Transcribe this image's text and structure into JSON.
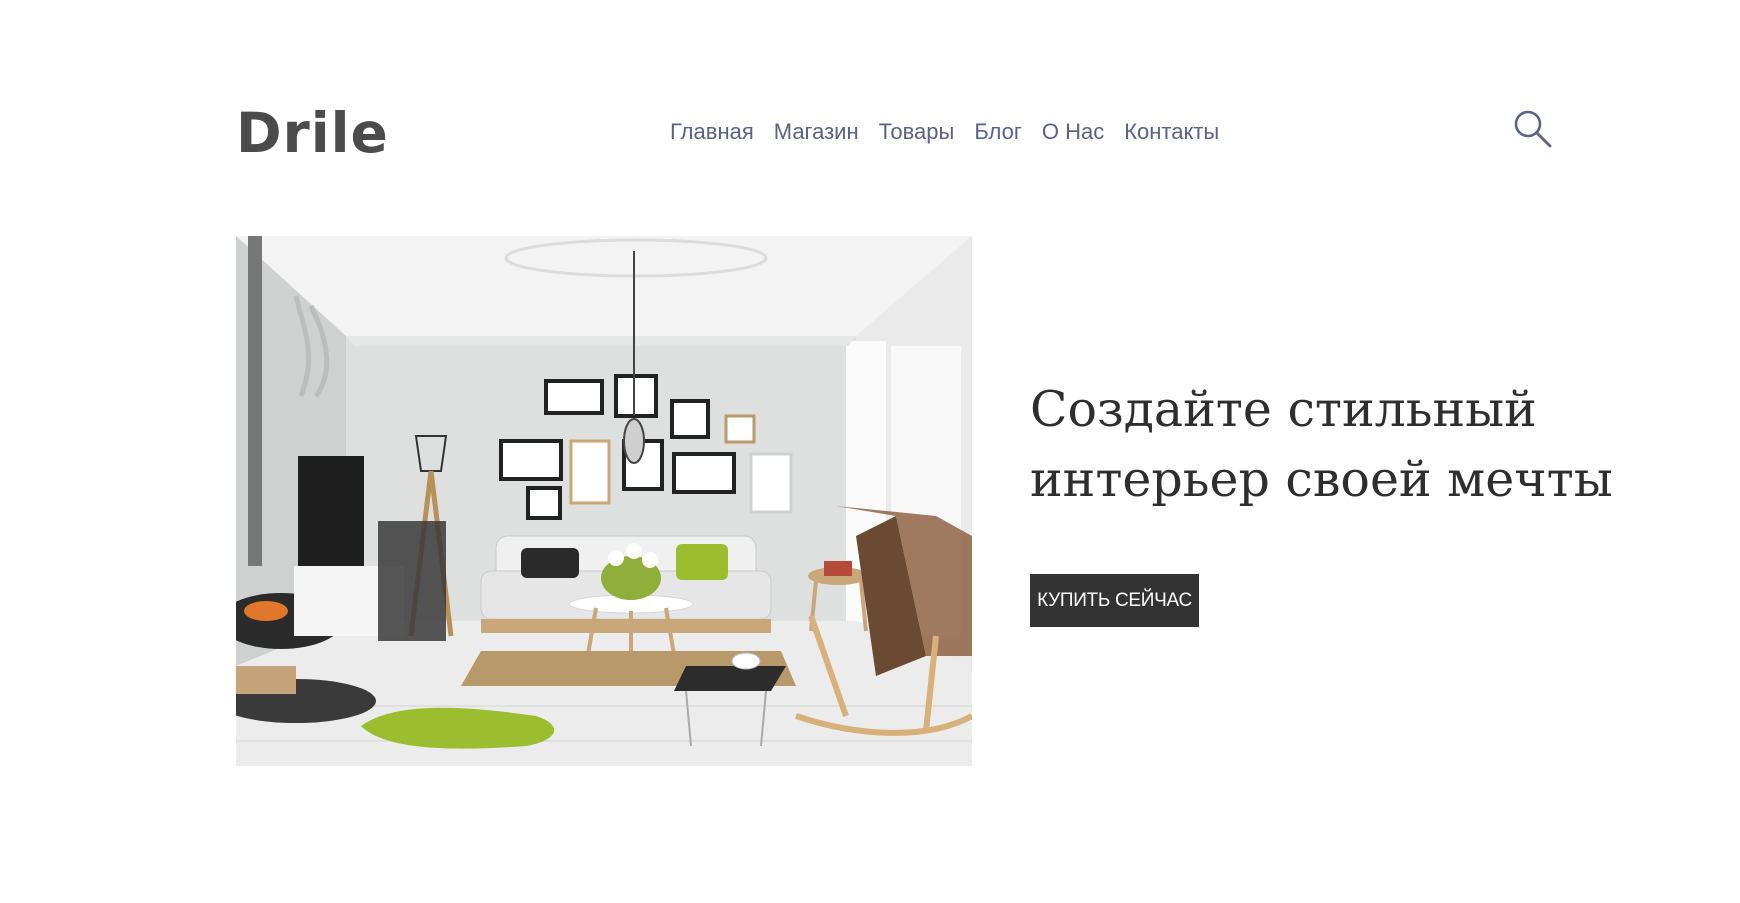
{
  "header": {
    "logo": "Drile",
    "nav": [
      "Главная",
      "Магазин",
      "Товары",
      "Блог",
      "О Нас",
      "Контакты"
    ],
    "search_icon": "search-icon"
  },
  "hero": {
    "title_line1": "Создайте стильный",
    "title_line2": "интерьер своей мечты",
    "cta_label": "КУПИТЬ СЕЙЧАС"
  },
  "colors": {
    "logo": "#4b4b4b",
    "nav": "#5a6188",
    "title": "#2e2e2e",
    "button_bg": "#333333",
    "button_text": "#ffffff",
    "accent_green": "#9bbd2f"
  }
}
